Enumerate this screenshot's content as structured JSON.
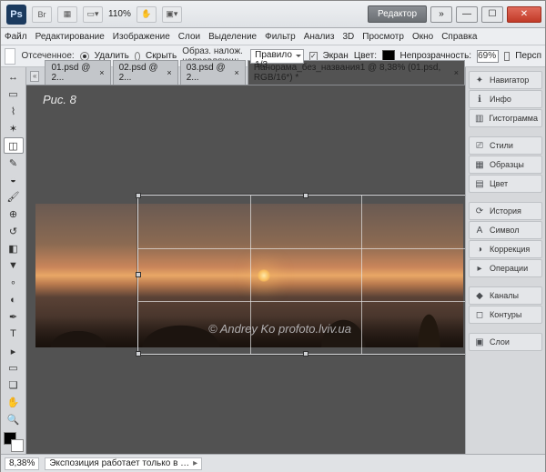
{
  "titlebar": {
    "zoom": "110%",
    "editor_button": "Редактор"
  },
  "menu": [
    "Файл",
    "Редактирование",
    "Изображение",
    "Слои",
    "Выделение",
    "Фильтр",
    "Анализ",
    "3D",
    "Просмотр",
    "Окно",
    "Справка"
  ],
  "options": {
    "clip_label": "Отсеченное:",
    "delete": "Удалить",
    "hide": "Скрыть",
    "overlay_label": "Образ. налож. направляющ:",
    "overlay_value": "Правило 1/3",
    "screen": "Экран",
    "color": "Цвет:",
    "opacity_label": "Непрозрачность:",
    "opacity_value": "69%",
    "persp": "Персп"
  },
  "tabs": [
    {
      "label": "01.psd @ 2...",
      "active": false
    },
    {
      "label": "02.psd @ 2...",
      "active": false
    },
    {
      "label": "03.psd @ 2...",
      "active": false
    },
    {
      "label": "Панорама_без_названия1 @ 8,38% (01.psd, RGB/16*) *",
      "active": true
    }
  ],
  "canvas": {
    "figure_label": "Рис. 8",
    "watermark": "©  Andrey  Ko      profoto.lviv.ua"
  },
  "status": {
    "zoom": "8,38%",
    "msg": "Экспозиция работает только в …"
  },
  "panels": [
    {
      "icon": "✦",
      "label": "Навигатор"
    },
    {
      "icon": "ℹ",
      "label": "Инфо"
    },
    {
      "icon": "▥",
      "label": "Гистограмма"
    },
    {
      "gap": true
    },
    {
      "icon": "⎚",
      "label": "Стили"
    },
    {
      "icon": "▦",
      "label": "Образцы"
    },
    {
      "icon": "▤",
      "label": "Цвет"
    },
    {
      "gap": true
    },
    {
      "icon": "⟳",
      "label": "История"
    },
    {
      "icon": "A",
      "label": "Символ"
    },
    {
      "icon": "◑",
      "label": "Коррекция"
    },
    {
      "icon": "▸",
      "label": "Операции"
    },
    {
      "gap": true
    },
    {
      "icon": "◆",
      "label": "Каналы"
    },
    {
      "icon": "◻",
      "label": "Контуры"
    },
    {
      "gap": true
    },
    {
      "icon": "▣",
      "label": "Слои"
    }
  ]
}
